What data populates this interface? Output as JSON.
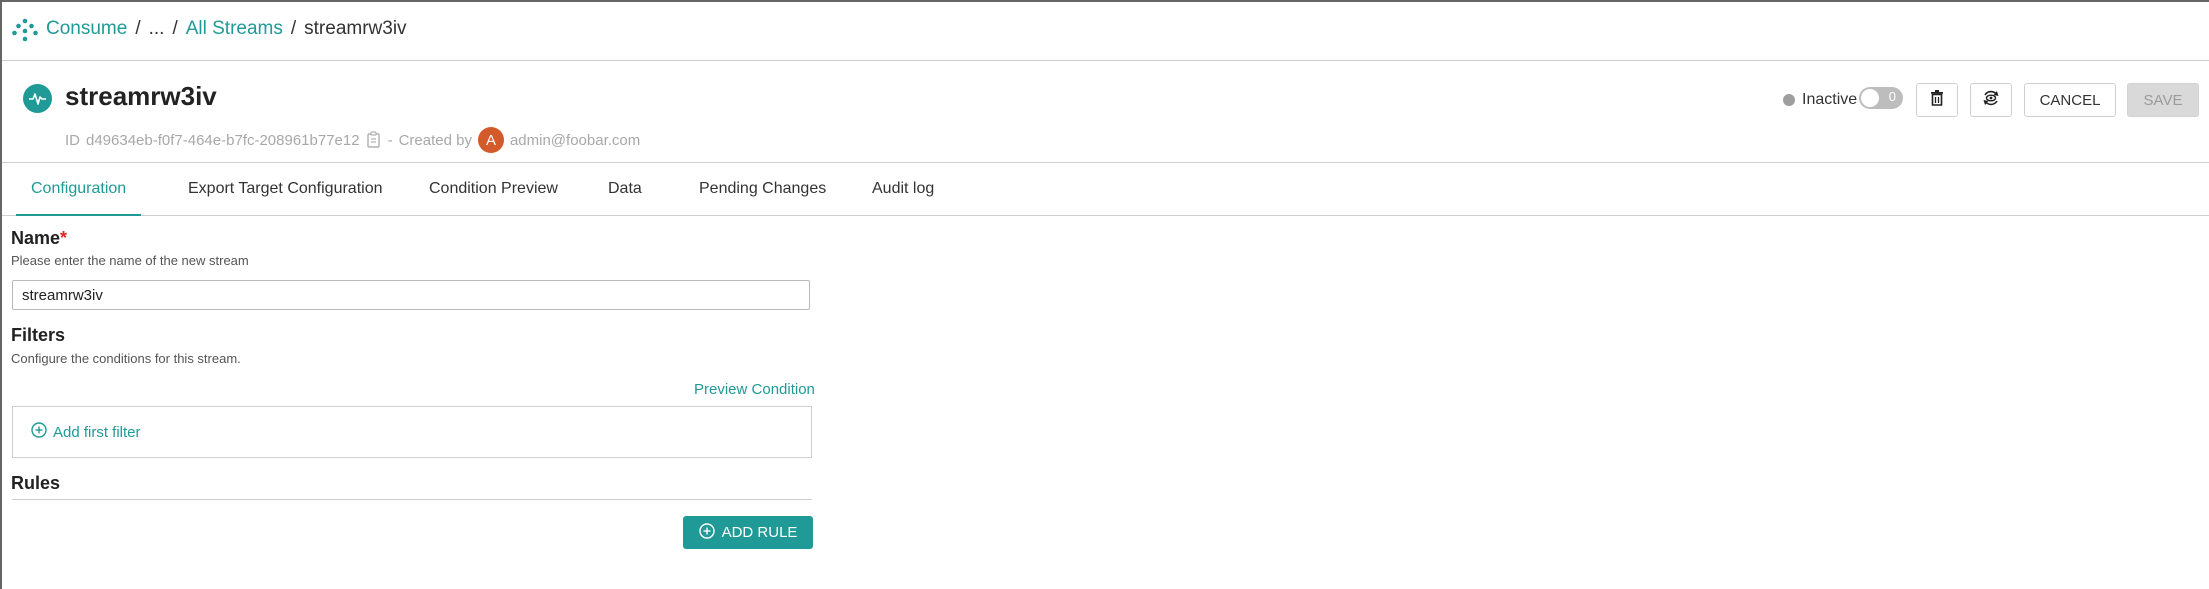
{
  "breadcrumb": {
    "items": [
      "Consume",
      "...",
      "All Streams"
    ],
    "separator": "/",
    "current": "streamrw3iv"
  },
  "header": {
    "title": "streamrw3iv",
    "id_label": "ID",
    "id_value": "d49634eb-f0f7-464e-b7fc-208961b77e12",
    "created_by_label": "Created by",
    "creator_initial": "A",
    "creator_email": "admin@foobar.com",
    "dash": "-",
    "status": "Inactive",
    "toggle_count": "0",
    "cancel_label": "CANCEL",
    "save_label": "SAVE"
  },
  "tabs": [
    {
      "label": "Configuration",
      "active": true
    },
    {
      "label": "Export Target Configuration",
      "active": false
    },
    {
      "label": "Condition Preview",
      "active": false
    },
    {
      "label": "Data",
      "active": false
    },
    {
      "label": "Pending Changes",
      "active": false
    },
    {
      "label": "Audit log",
      "active": false
    }
  ],
  "form": {
    "name_label": "Name",
    "required_mark": "*",
    "name_help": "Please enter the name of the new stream",
    "name_value": "streamrw3iv",
    "filters_label": "Filters",
    "filters_help": "Configure the conditions for this stream.",
    "preview_condition": "Preview Condition",
    "add_first_filter": "Add first filter",
    "rules_label": "Rules",
    "add_rule": "ADD RULE"
  },
  "colors": {
    "accent": "#1f9a96",
    "avatar": "#d25a2b",
    "required": "#e02424"
  }
}
